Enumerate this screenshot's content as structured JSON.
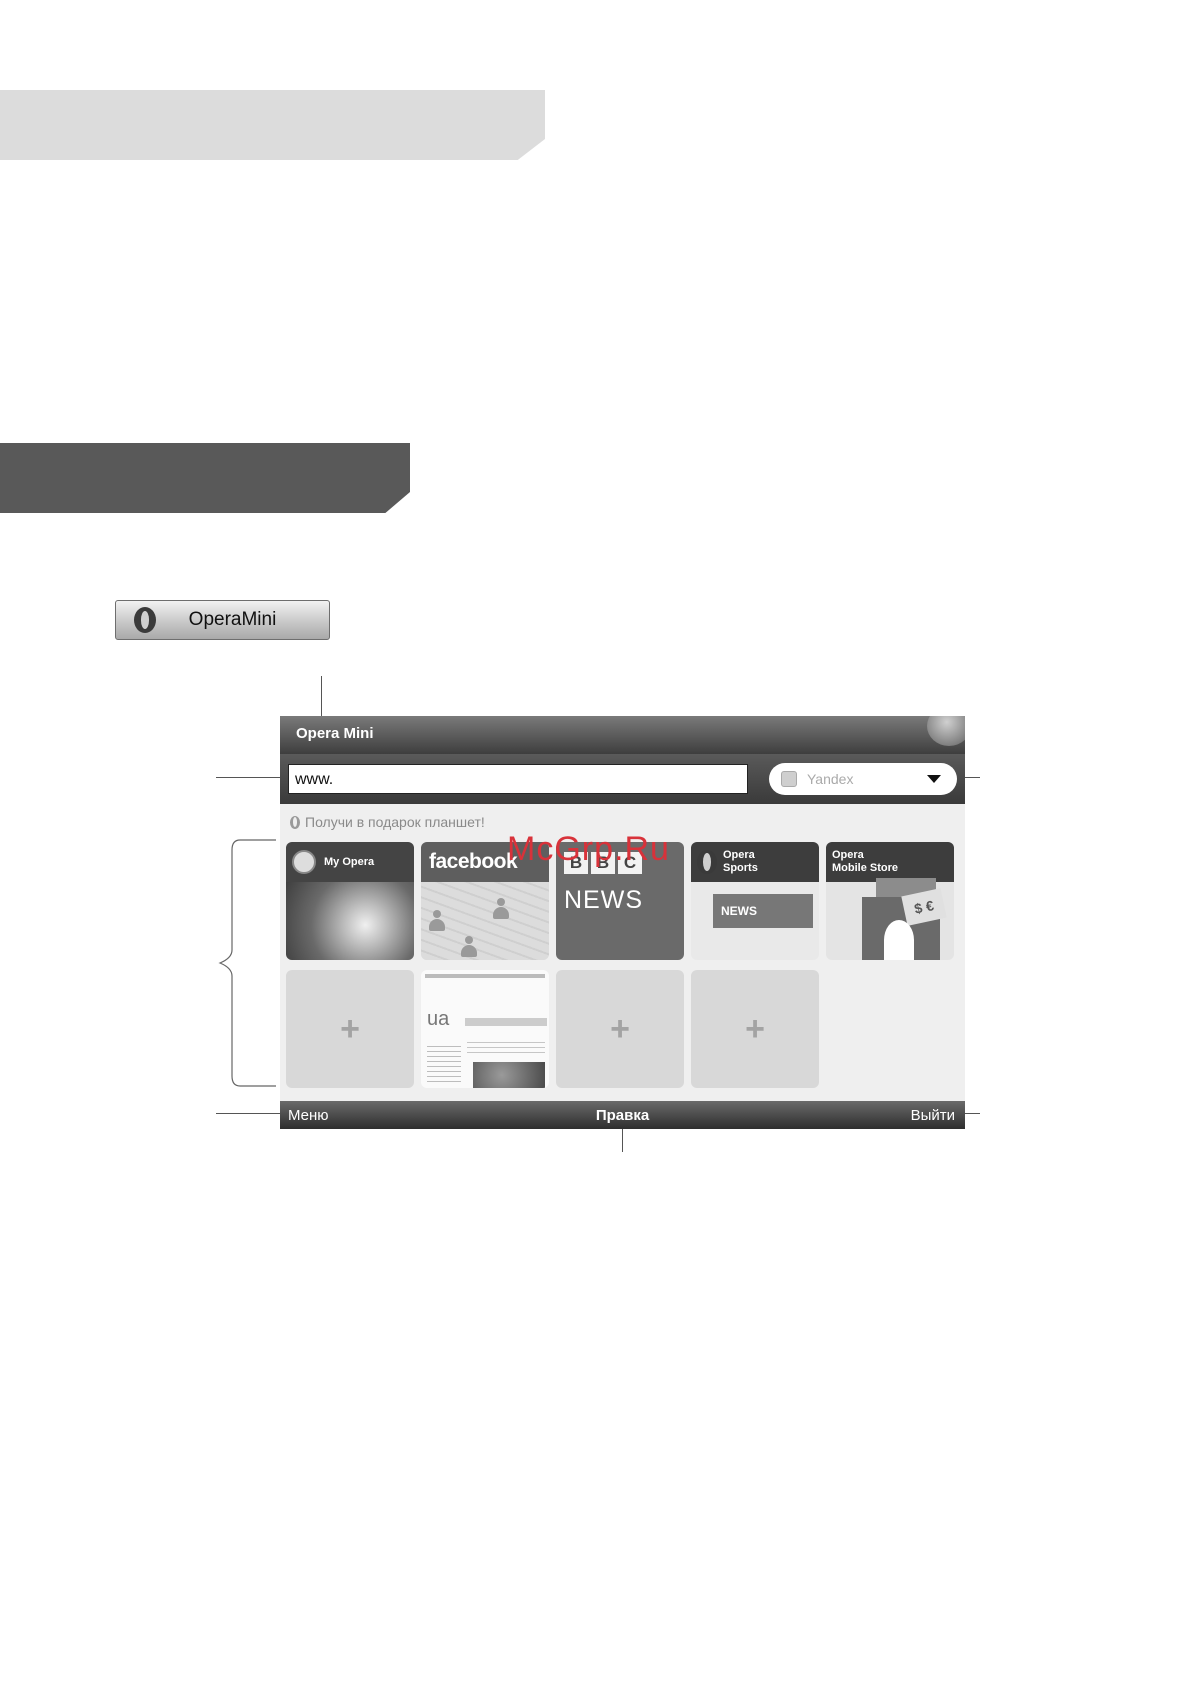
{
  "app_button": {
    "label": "OperaMini",
    "icon": "opera-o-icon"
  },
  "browser": {
    "title": "Opera Mini",
    "address": {
      "value": "www."
    },
    "search": {
      "engine": "Yandex",
      "icon": "dropdown-caret-icon"
    },
    "promo": "Получи в подарок планшет!",
    "speed_dial": [
      {
        "name": "My Opera"
      },
      {
        "name": "facebook"
      },
      {
        "name": "BBC NEWS",
        "blocks": [
          "B",
          "B",
          "C"
        ],
        "sub": "NEWS"
      },
      {
        "name_line1": "Opera",
        "name_line2": "Sports",
        "badge": "NEWS"
      },
      {
        "name_line1": "Opera",
        "name_line2": "Mobile Store",
        "money": "$ €"
      },
      {
        "name": "",
        "symbol": "+"
      },
      {
        "name": "",
        "logo": "ua"
      },
      {
        "name": "",
        "symbol": "+"
      },
      {
        "name": "",
        "symbol": "+"
      }
    ],
    "softkeys": {
      "left": "Меню",
      "center": "Правка",
      "right": "Выйти"
    }
  },
  "watermark": "McGrp.Ru"
}
